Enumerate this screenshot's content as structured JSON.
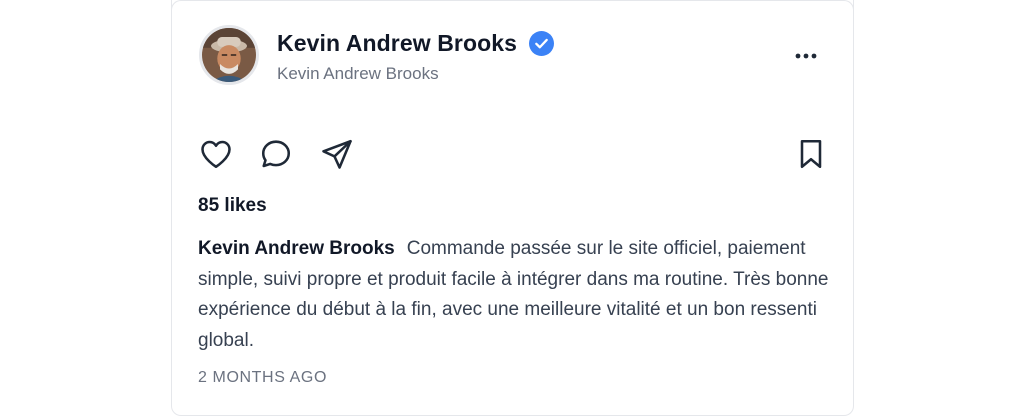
{
  "post": {
    "author": {
      "display_name": "Kevin Andrew Brooks",
      "handle": "Kevin Andrew Brooks",
      "verified": true,
      "avatar_icon": "avatar-photo"
    },
    "actions": {
      "like_icon": "heart-icon",
      "comment_icon": "comment-icon",
      "share_icon": "send-icon",
      "save_icon": "bookmark-icon",
      "more_icon": "more-horizontal-icon"
    },
    "likes_label": "85 likes",
    "caption": {
      "author": "Kevin Andrew Brooks",
      "text": "Commande passée sur le site officiel, paiement simple, suivi propre et produit facile à intégrer dans ma routine. Très bonne expérience du début à la fin, avec une meilleure vitalité et un bon ressenti global."
    },
    "timestamp": "2 MONTHS AGO"
  },
  "colors": {
    "text_primary": "#111827",
    "text_secondary": "#6b7280",
    "verified_blue": "#3b82f6",
    "border": "#e5e7eb"
  }
}
